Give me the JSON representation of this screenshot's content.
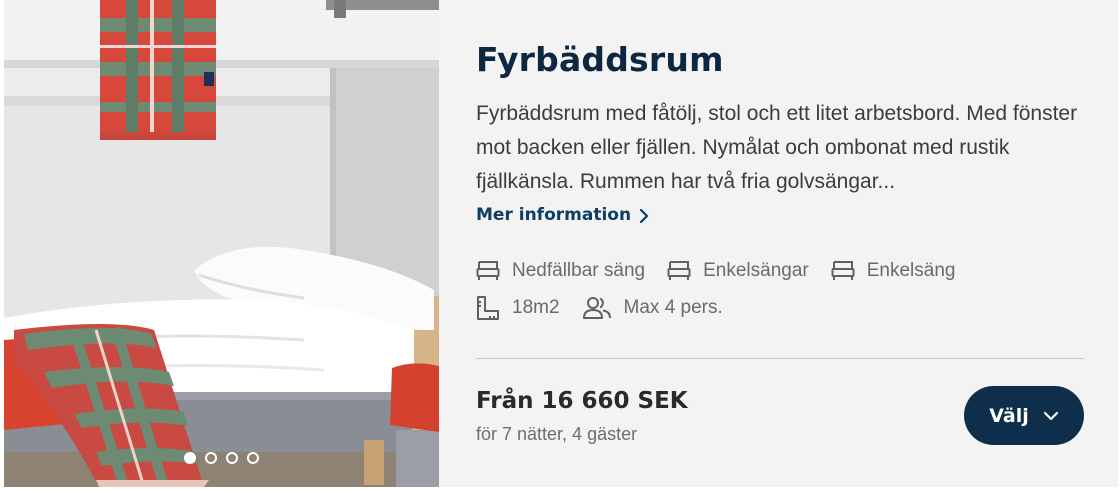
{
  "room": {
    "title": "Fyrbäddsrum",
    "description": "Fyrbäddsrum med fåtölj, stol och ett litet arbetsbord. Med fönster mot backen eller fjällen. Nymålat och ombonat med rustik fjällkänsla. Rummen har två fria golvsängar...",
    "more_info_label": "Mer information",
    "features_row1": [
      {
        "icon": "bed-icon",
        "label": "Nedfällbar säng"
      },
      {
        "icon": "bed-icon",
        "label": "Enkelsängar"
      },
      {
        "icon": "bed-icon",
        "label": "Enkelsäng"
      }
    ],
    "features_row2": [
      {
        "icon": "ruler-icon",
        "label": "18m2"
      },
      {
        "icon": "guests-icon",
        "label": "Max 4 pers."
      }
    ],
    "price": "Från 16 660 SEK",
    "price_details": "för 7 nätter, 4 gäster",
    "select_label": "Välj"
  },
  "carousel": {
    "slide_count": 4,
    "active_index": 0
  },
  "colors": {
    "card_background": "#f3f3f3",
    "title": "#0e2741",
    "link": "#0f3d63",
    "button": "#0f2e4b"
  }
}
